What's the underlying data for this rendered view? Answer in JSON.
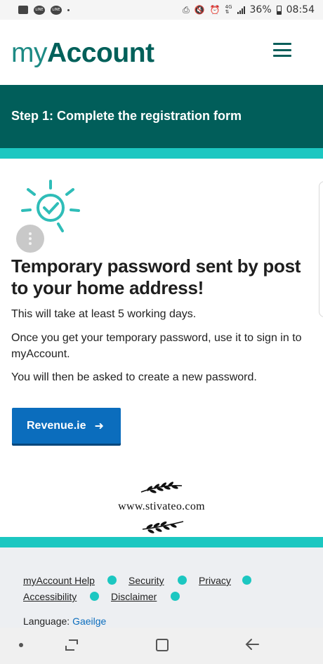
{
  "status_bar": {
    "network": "4G",
    "battery_percent": "36%",
    "time": "08:54",
    "icons": [
      "image-icon",
      "line-icon",
      "line-icon",
      "dot-icon",
      "wifi-calling-icon",
      "mute-icon",
      "alarm-icon",
      "signal-icon",
      "battery-icon"
    ]
  },
  "header": {
    "logo_prefix": "my",
    "logo_bold": "Account",
    "menu_icon": "hamburger-menu-icon"
  },
  "step": {
    "title": "Step 1: Complete the registration form"
  },
  "main": {
    "illustration_icon": "check-sun-icon",
    "headline": "Temporary password sent by post to your home address!",
    "paragraphs": [
      "This will take at least 5 working days.",
      "Once you get your temporary password, use it to sign in to myAccount.",
      "You will then be asked to create a new password."
    ],
    "cta_label": "Revenue.ie",
    "cta_icon": "arrow-right-icon"
  },
  "watermark": {
    "text": "www.stivateo.com"
  },
  "footer": {
    "links": [
      "myAccount Help",
      "Security",
      "Privacy",
      "Accessibility",
      "Disclaimer"
    ],
    "language_label": "Language:",
    "language_link": "Gaeilge"
  },
  "colors": {
    "brand_dark": "#015e5a",
    "brand_light": "#1cc7c1",
    "button_blue": "#0b6dbd"
  }
}
